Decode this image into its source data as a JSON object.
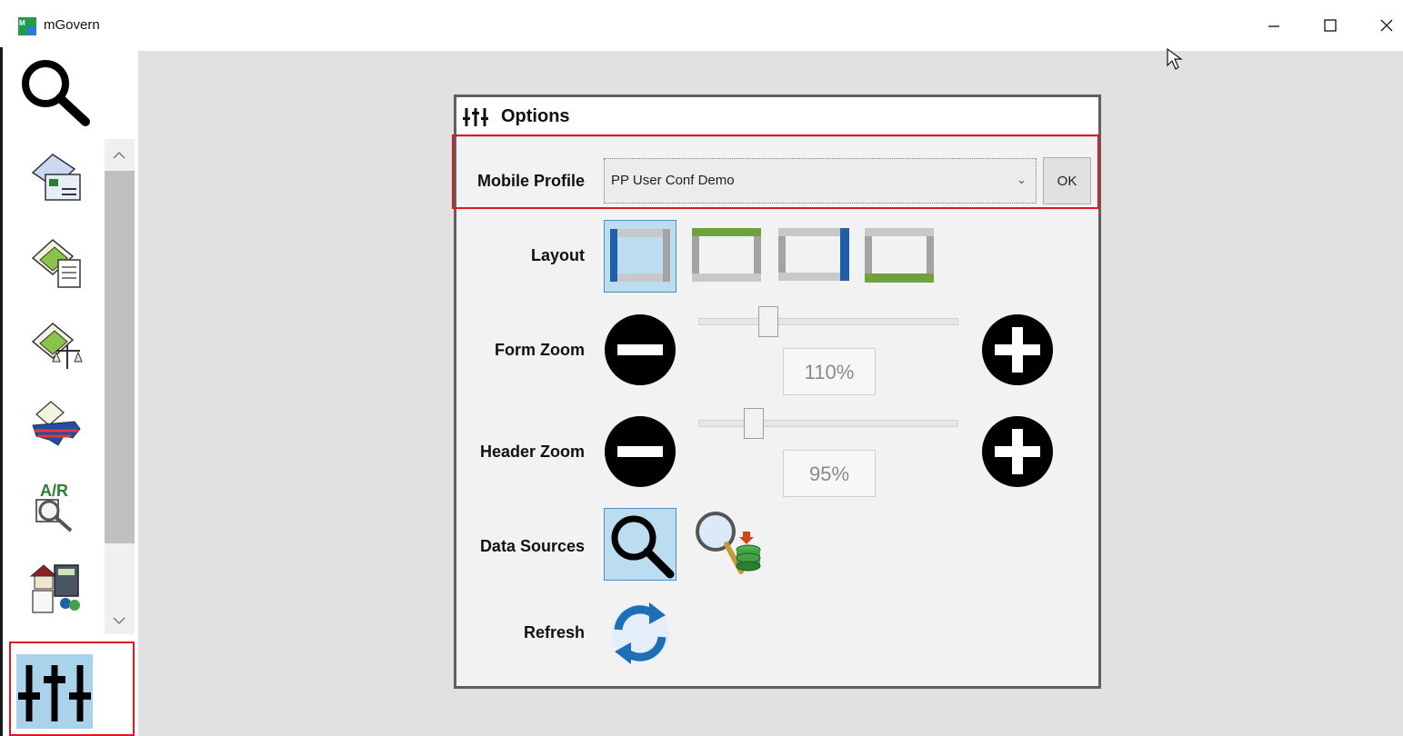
{
  "window": {
    "title": "mGovern",
    "minimize_glyph": "–",
    "maximize_glyph": "☐",
    "close_glyph": "✕"
  },
  "sidebar": {
    "items": [
      {
        "name": "search-icon"
      },
      {
        "name": "billing-cards-icon"
      },
      {
        "name": "documents-icon"
      },
      {
        "name": "legal-scales-icon"
      },
      {
        "name": "usa-map-icon"
      },
      {
        "name": "ar-lookup-icon"
      },
      {
        "name": "calculator-house-icon"
      },
      {
        "name": "options-sliders-icon",
        "active": true
      }
    ]
  },
  "options_dialog": {
    "title": "Options",
    "mobile_profile": {
      "label": "Mobile Profile",
      "selected": "PP User Conf Demo",
      "ok_label": "OK"
    },
    "layout": {
      "label": "Layout",
      "options": [
        "left-bar",
        "top-bar",
        "right-bar",
        "bottom-bar"
      ],
      "selected_index": 0
    },
    "form_zoom": {
      "label": "Form Zoom",
      "value": "110%",
      "slider_fraction": 0.25
    },
    "header_zoom": {
      "label": "Header Zoom",
      "value": "95%",
      "slider_fraction": 0.19
    },
    "data_sources": {
      "label": "Data Sources",
      "options": [
        "search-icon",
        "database-search-icon"
      ],
      "selected_index": 0
    },
    "refresh": {
      "label": "Refresh"
    }
  },
  "colors": {
    "accent_blue": "#1e5fa8",
    "accent_green": "#6fa23a",
    "highlight_red": "#e0171d",
    "selected_bg": "#bcdcef"
  }
}
